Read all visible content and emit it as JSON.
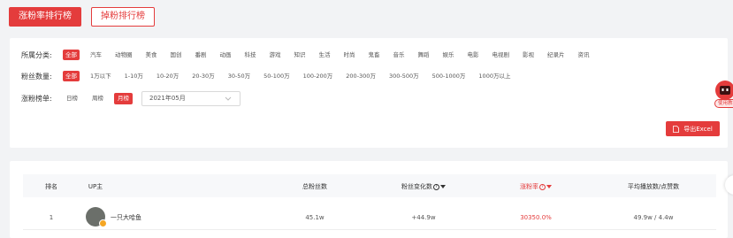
{
  "top_tabs": {
    "active": "涨粉率排行榜",
    "inactive": "掉粉排行榜"
  },
  "filters": {
    "category": {
      "label": "所属分类:",
      "options": [
        "全部",
        "汽车",
        "动物圈",
        "美食",
        "国创",
        "番剧",
        "动画",
        "科技",
        "游戏",
        "知识",
        "生活",
        "时尚",
        "鬼畜",
        "音乐",
        "舞蹈",
        "娱乐",
        "电影",
        "电视剧",
        "影视",
        "纪录片",
        "资讯"
      ],
      "active_index": 0
    },
    "fans": {
      "label": "粉丝数量:",
      "options": [
        "全部",
        "1万以下",
        "1-10万",
        "10-20万",
        "20-30万",
        "30-50万",
        "50-100万",
        "100-200万",
        "200-300万",
        "300-500万",
        "500-1000万",
        "1000万以上"
      ],
      "active_index": 0
    },
    "board": {
      "label": "涨粉榜单:",
      "options": [
        "日榜",
        "周榜",
        "月榜"
      ],
      "active_index": 2,
      "month_value": "2021年05月"
    }
  },
  "export": {
    "label": "导出Excel"
  },
  "float_widget": {
    "label": "使用教程"
  },
  "table": {
    "headers": {
      "rank": "排名",
      "up": "UP主",
      "total": "总粉丝数",
      "change": "粉丝变化数",
      "rate": "涨粉率",
      "avg": "平均播放数/点赞数"
    },
    "rows": [
      {
        "rank": "1",
        "name": "一只大哈鱼",
        "total": "45.1w",
        "change": "+44.9w",
        "rate": "30350.0%",
        "avg": "49.9w / 4.4w"
      }
    ]
  },
  "colors": {
    "accent": "#e43c3c"
  },
  "icons": {
    "help": "question-circle-icon",
    "sort": "sort-down-icon",
    "export": "file-icon",
    "select": "chevron-down-icon"
  }
}
